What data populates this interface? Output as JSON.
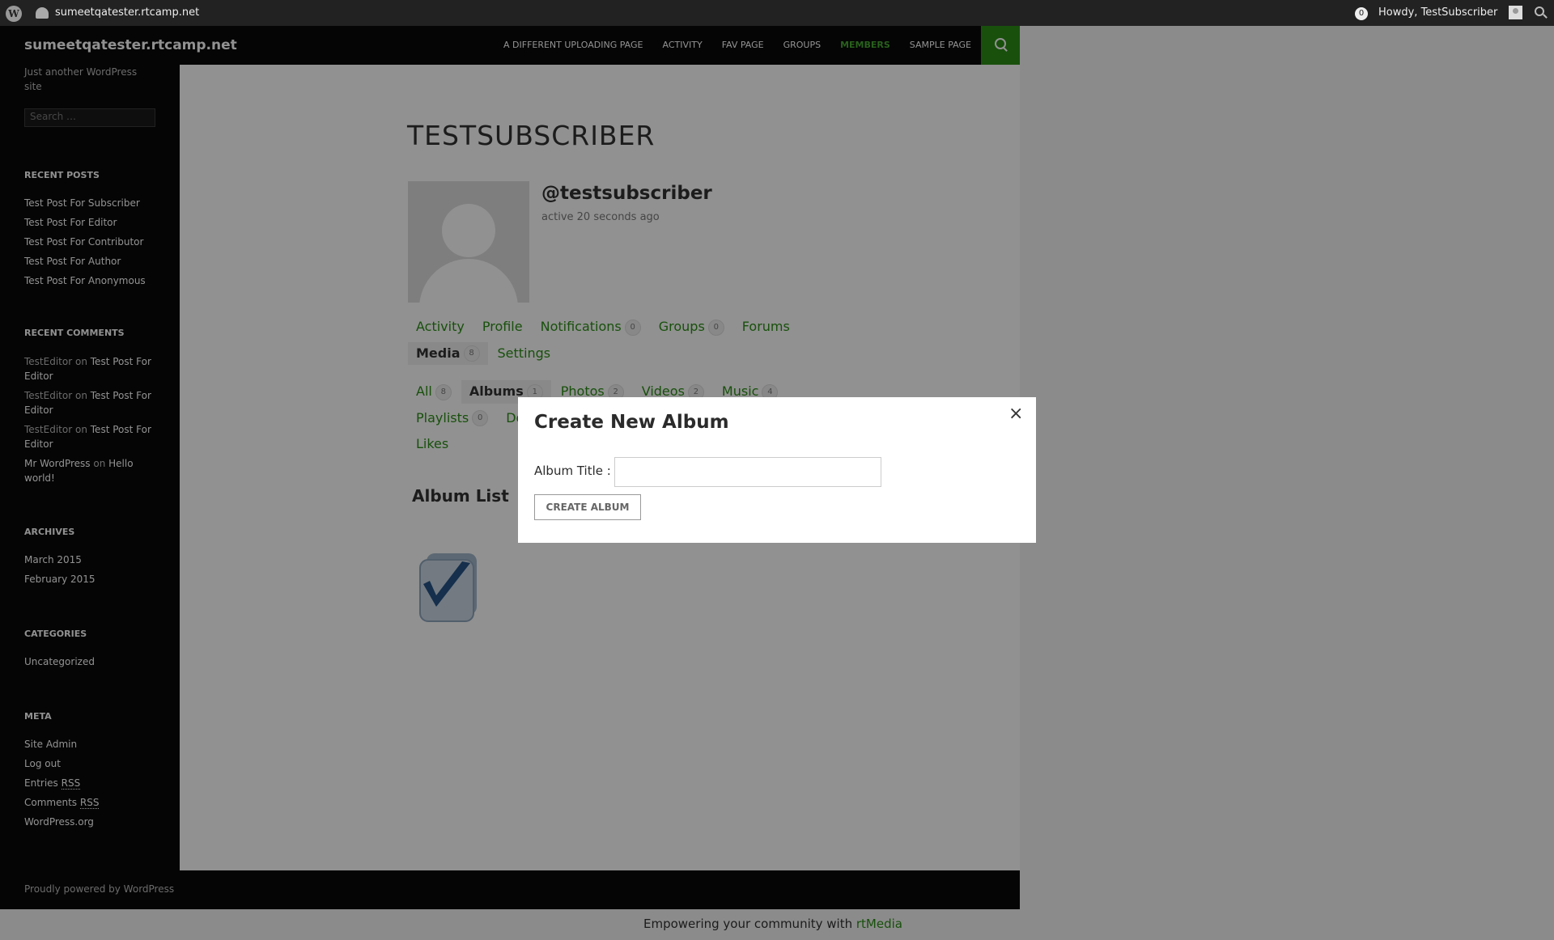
{
  "adminbar": {
    "site_name": "sumeetqatester.rtcamp.net",
    "notification_count": "0",
    "howdy": "Howdy, TestSubscriber"
  },
  "header": {
    "site_title": "sumeetqatester.rtcamp.net",
    "nav": [
      "A DIFFERENT UPLOADING PAGE",
      "ACTIVITY",
      "FAV PAGE",
      "GROUPS",
      "MEMBERS",
      "SAMPLE PAGE"
    ],
    "active_nav": "MEMBERS"
  },
  "sidebar": {
    "description": "Just another WordPress site",
    "search_placeholder": "Search …",
    "recent_posts_title": "RECENT POSTS",
    "recent_posts": [
      "Test Post For Subscriber",
      "Test Post For Editor",
      "Test Post For Contributor",
      "Test Post For Author",
      "Test Post For Anonymous"
    ],
    "recent_comments_title": "RECENT COMMENTS",
    "recent_comments": [
      {
        "author": "TestEditor",
        "on": "on",
        "post": "Test Post For Editor"
      },
      {
        "author": "TestEditor",
        "on": "on",
        "post": "Test Post For Editor"
      },
      {
        "author": "TestEditor",
        "on": "on",
        "post": "Test Post For Editor"
      },
      {
        "author": "Mr WordPress",
        "on": "on",
        "post": "Hello world!"
      }
    ],
    "archives_title": "ARCHIVES",
    "archives": [
      "March 2015",
      "February 2015"
    ],
    "categories_title": "CATEGORIES",
    "categories": [
      "Uncategorized"
    ],
    "meta_title": "META",
    "meta": {
      "site_admin": "Site Admin",
      "log_out": "Log out",
      "entries": "Entries",
      "comments": "Comments",
      "rss": "RSS",
      "wordpress_org": "WordPress.org"
    }
  },
  "profile": {
    "title": "TESTSUBSCRIBER",
    "handle": "@testsubscriber",
    "activity": "active 20 seconds ago",
    "nav": [
      {
        "label": "Activity"
      },
      {
        "label": "Profile"
      },
      {
        "label": "Notifications",
        "count": "0"
      },
      {
        "label": "Groups",
        "count": "0"
      },
      {
        "label": "Forums"
      },
      {
        "label": "Media",
        "count": "8"
      },
      {
        "label": "Settings"
      }
    ],
    "media_nav": [
      {
        "label": "All",
        "count": "8"
      },
      {
        "label": "Albums",
        "count": "1"
      },
      {
        "label": "Photos",
        "count": "2"
      },
      {
        "label": "Videos",
        "count": "2"
      },
      {
        "label": "Music",
        "count": "4"
      },
      {
        "label": "Playlists",
        "count": "0"
      },
      {
        "label": "Do"
      },
      {
        "label": "Likes"
      }
    ],
    "album_list_title": "Album List"
  },
  "footer": {
    "powered_by": "Proudly powered by WordPress",
    "rt_text": "Empowering your community with",
    "rt_link": "rtMedia"
  },
  "modal": {
    "title": "Create New Album",
    "close": "×",
    "album_title_label": "Album Title :",
    "album_title_value": "",
    "create_button": "CREATE ALBUM"
  }
}
